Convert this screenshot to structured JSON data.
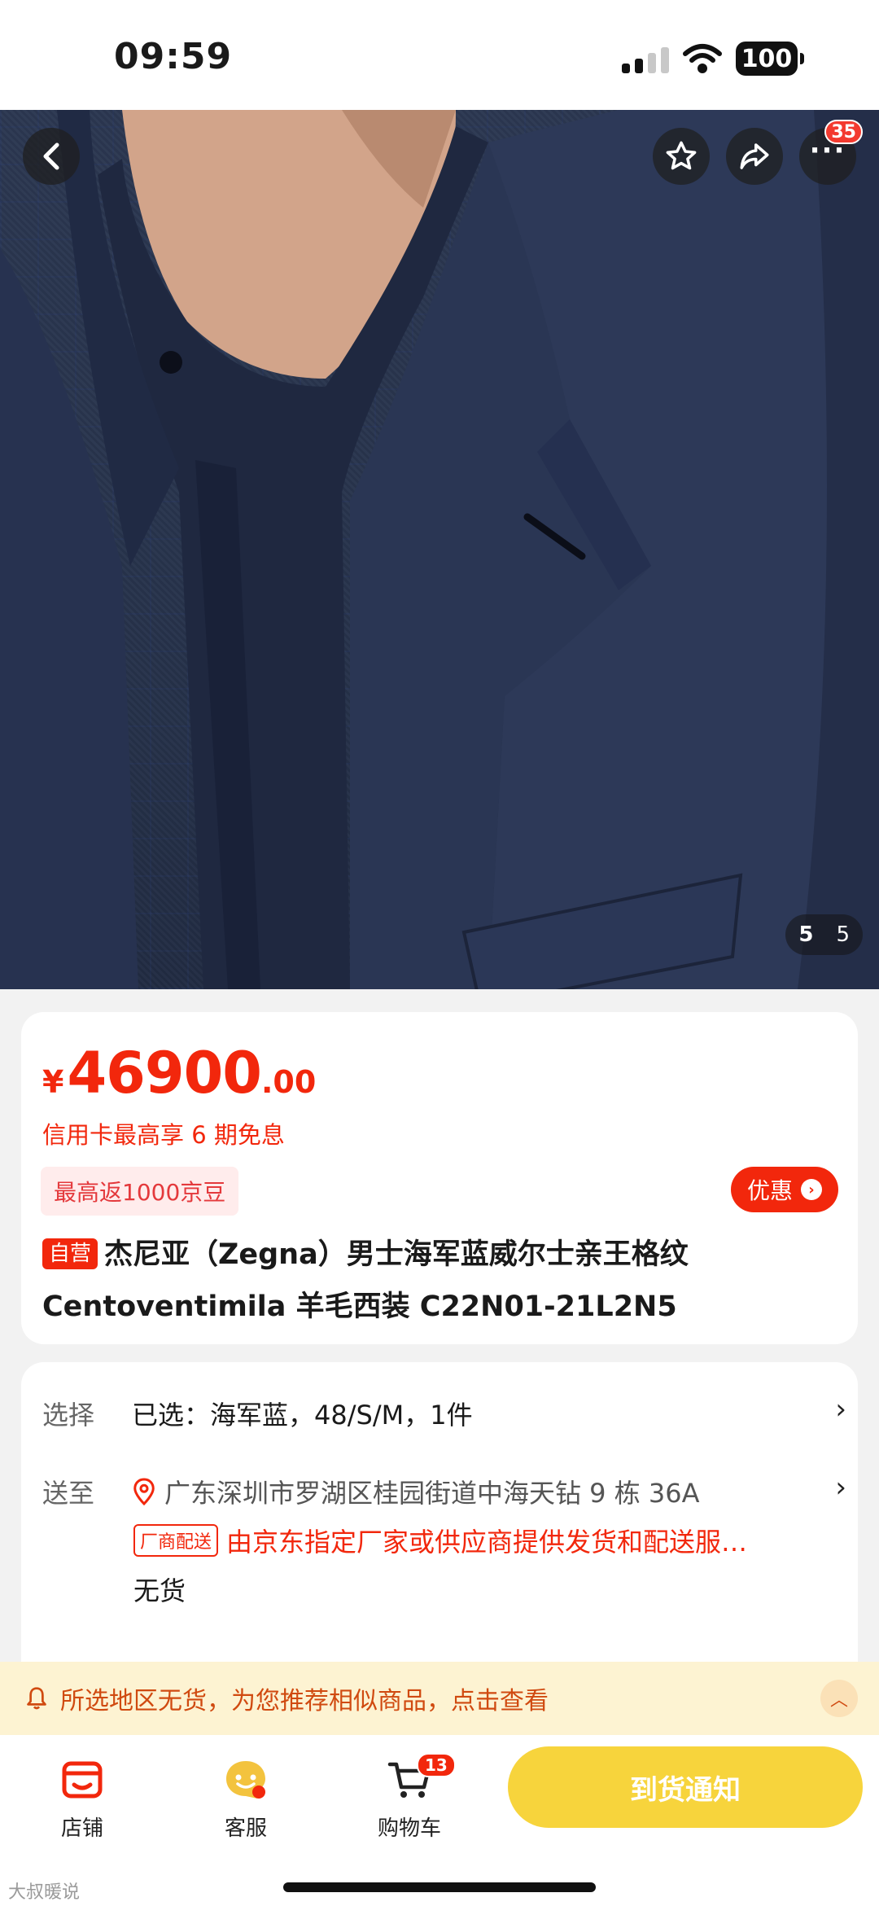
{
  "status_bar": {
    "time": "09:59",
    "battery": "100"
  },
  "hero": {
    "pager_current": "5",
    "pager_total": "5",
    "more_badge": "35"
  },
  "product": {
    "currency": "¥",
    "price_int": "46900",
    "price_dec": ".00",
    "installment": "信用卡最高享 6 期免息",
    "jd_bean": "最高返1000京豆",
    "promo_label": "优惠",
    "self_tag": "自营",
    "title": "杰尼亚（Zegna）男士海军蓝威尔士亲王格纹 Centoventimila 羊毛西装 C22N01-21L2N5"
  },
  "details": {
    "select_label": "选择",
    "select_value": "已选：海军蓝，48/S/M，1件",
    "ship_label": "送至",
    "address": "广东深圳市罗湖区桂园街道中海天钻 9 栋 36A",
    "factory_tag": "厂商配送",
    "factory_text": "由京东指定厂家或供应商提供发货和配送服…",
    "stock": "无货"
  },
  "notice": {
    "text": "所选地区无货，为您推荐相似商品，点击查看"
  },
  "bottom_bar": {
    "shop": "店铺",
    "service": "客服",
    "cart": "购物车",
    "cart_count": "13",
    "notify": "到货通知"
  },
  "watermark": "大叔暖说",
  "colors": {
    "accent": "#f2270c",
    "notify_button": "#f7d43c",
    "notice_bg": "#fdf3d2"
  }
}
